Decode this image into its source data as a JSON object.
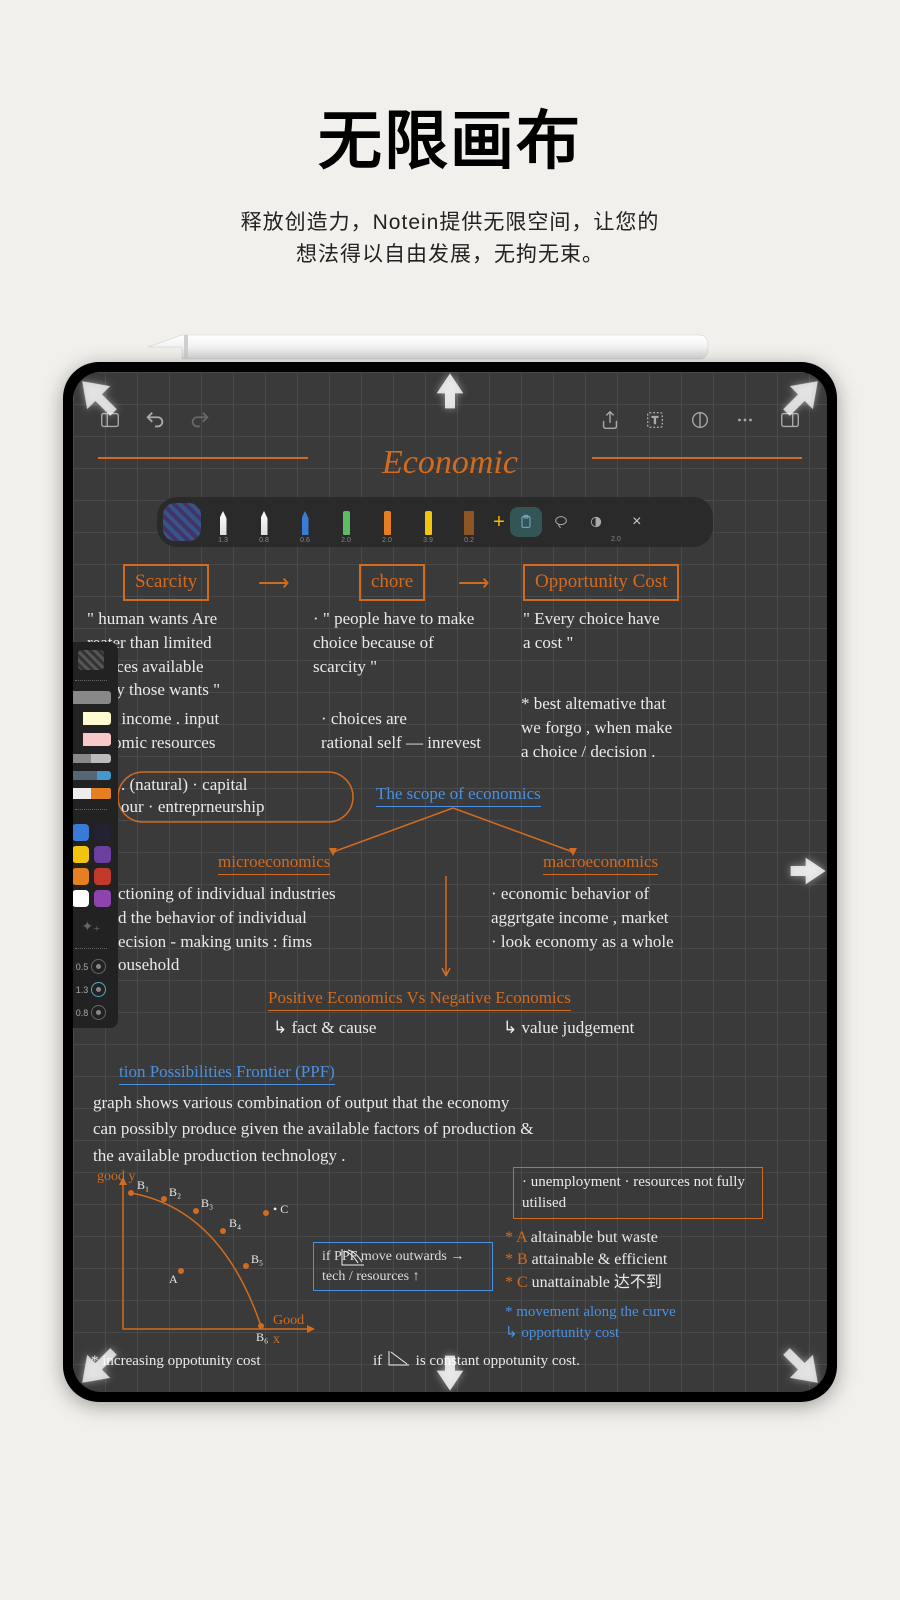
{
  "marketing": {
    "title": "无限画布",
    "subtitle_l1": "释放创造力，Notein提供无限空间，让您的",
    "subtitle_l2": "想法得以自由发展，无拘无束。"
  },
  "topbar": {
    "icons": [
      "panel-icon",
      "undo-icon",
      "redo-icon",
      "share-icon",
      "text-icon",
      "shape-icon",
      "more-icon",
      "sidebar-icon"
    ]
  },
  "horizontal_toolbar": {
    "pens": [
      {
        "color": "white",
        "size": "1.3"
      },
      {
        "color": "white",
        "size": "0.8"
      },
      {
        "color": "blue",
        "size": "0.6"
      },
      {
        "color": "green",
        "size": "2.0"
      },
      {
        "color": "orange",
        "size": "2.0"
      },
      {
        "color": "yellow",
        "size": "3.9"
      },
      {
        "color": "brown",
        "size": "0.2"
      }
    ],
    "clipboard_label": "📋",
    "lasso_label": "◯",
    "eraser_label": "◐",
    "eraser_size": "2.0"
  },
  "vertical_toolbar": {
    "colors": [
      "#3a7bd5",
      "#223",
      "#f1c40f",
      "#6b3fa0",
      "#e67e22",
      "#c0392b",
      "#ffffff",
      "#8e44ad"
    ],
    "sizes": [
      "0.5",
      "1.3",
      "0.8"
    ]
  },
  "page": {
    "title": "Economic",
    "top_boxes": {
      "b1": "Scarcity",
      "b2": "chore",
      "b3": "Opportunity  Cost"
    },
    "col1": {
      "t1": "\" human  wants  Are\n  reater  than  limited\n  sources  available\n   satify  those  wants \"",
      "t2": ".  income . input\n  omic  resources",
      "t3": ". (natural) · capital\n  our  ·  entreprneurship"
    },
    "col2": {
      "t1": "· \" people  have  to  make\n   choice  because   of\n   scarcity \"",
      "t2": "· choices   are\n  rational self — inrevest"
    },
    "col3": {
      "t1": "\" Every  choice   have\n   a  cost \"",
      "t2": "*  best  altemative  that\n   we  forgo , when   make\n   a  choice / decision ."
    },
    "mid": {
      "scope": "The  scope  of  economics",
      "micro": "microeconomics",
      "macro": "macroeconomics",
      "micro_t": "ctioning of  individual   industries\n d  the  behavior  of  individual\n ecision - making  units :  fims\n  ousehold",
      "macro_t": "· economic  behavior  of\n  aggrtgate  income , market\n· look  economy  as  a  whole",
      "pos_neg": "Positive   Economics   Vs   Negative   Economics",
      "pos": "↳ fact  &  cause",
      "neg": "↳ value  judgement"
    },
    "ppf": {
      "title": "tion  Possibilities  Frontier (PPF)",
      "body": "  graph  shows   various   combination   of  output   that   the  economy\ncan   possibly   produce  given  the  available   factors   of  production  &\nthe   available  production   technology ."
    },
    "graph": {
      "ylabel": "good y",
      "xlabel": "Good\n  x",
      "pts": [
        "B₁",
        "B₂",
        "B₃",
        "B₄",
        "B₅",
        "B₆",
        "A",
        "C"
      ],
      "bottom": "* increasing   oppotunity   cost"
    },
    "ppf_if": "if       PPF  move\noutwards → tech / resources ↑",
    "side_box": "· unemployment\n· resources  not fully utilised",
    "side_list": "* A   altainable  but  waste\n* B   attainable  & efficient\n* C   unattainable  达不到",
    "side_move": "* movement   along   the  curve\n   ↳ opportunity  cost",
    "bottom_right": "if       is  constant  oppotunity   cost."
  }
}
